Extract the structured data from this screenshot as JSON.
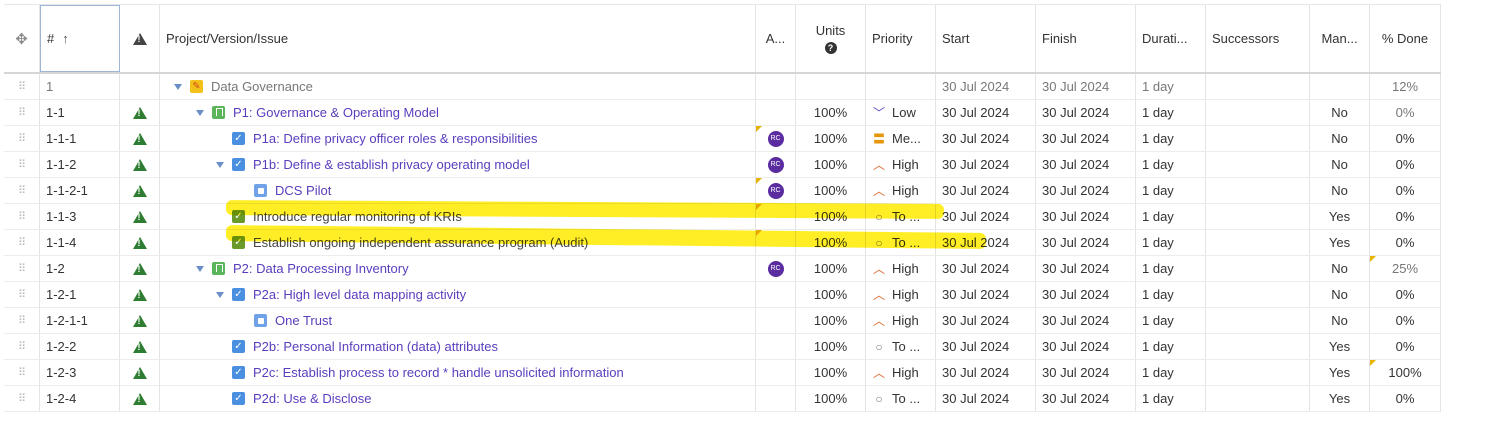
{
  "header": {
    "num": "#",
    "name": "Project/Version/Issue",
    "a": "A...",
    "units": "Units",
    "priority": "Priority",
    "start": "Start",
    "finish": "Finish",
    "duration": "Durati...",
    "successors": "Successors",
    "manual": "Man...",
    "done": "% Done"
  },
  "rows": [
    {
      "num": "1",
      "name": "Data Governance",
      "units": "",
      "priority": "",
      "start": "30 Jul 2024",
      "finish": "30 Jul 2024",
      "duration": "1 day",
      "manual": "",
      "done": "12%"
    },
    {
      "num": "1-1",
      "name": "P1: Governance & Operating Model",
      "units": "100%",
      "priority": "Low",
      "start": "30 Jul 2024",
      "finish": "30 Jul 2024",
      "duration": "1 day",
      "manual": "No",
      "done": "0%"
    },
    {
      "num": "1-1-1",
      "name": "P1a: Define privacy officer roles & responsibilities",
      "units": "100%",
      "priority": "Me...",
      "start": "30 Jul 2024",
      "finish": "30 Jul 2024",
      "duration": "1 day",
      "manual": "No",
      "done": "0%",
      "avatar": "RC"
    },
    {
      "num": "1-1-2",
      "name": "P1b: Define & establish privacy operating model",
      "units": "100%",
      "priority": "High",
      "start": "30 Jul 2024",
      "finish": "30 Jul 2024",
      "duration": "1 day",
      "manual": "No",
      "done": "0%",
      "avatar": "RC"
    },
    {
      "num": "1-1-2-1",
      "name": "DCS Pilot",
      "units": "100%",
      "priority": "High",
      "start": "30 Jul 2024",
      "finish": "30 Jul 2024",
      "duration": "1 day",
      "manual": "No",
      "done": "0%",
      "avatar": "RC"
    },
    {
      "num": "1-1-3",
      "name": "Introduce regular monitoring of KRIs",
      "units": "100%",
      "priority": "To ...",
      "start": "30 Jul 2024",
      "finish": "30 Jul 2024",
      "duration": "1 day",
      "manual": "Yes",
      "done": "0%"
    },
    {
      "num": "1-1-4",
      "name": "Establish ongoing independent assurance program (Audit)",
      "units": "100%",
      "priority": "To ...",
      "start": "30 Jul 2024",
      "finish": "30 Jul 2024",
      "duration": "1 day",
      "manual": "Yes",
      "done": "0%"
    },
    {
      "num": "1-2",
      "name": "P2: Data Processing Inventory",
      "units": "100%",
      "priority": "High",
      "start": "30 Jul 2024",
      "finish": "30 Jul 2024",
      "duration": "1 day",
      "manual": "No",
      "done": "25%",
      "avatar": "RC"
    },
    {
      "num": "1-2-1",
      "name": "P2a: High level data mapping activity",
      "units": "100%",
      "priority": "High",
      "start": "30 Jul 2024",
      "finish": "30 Jul 2024",
      "duration": "1 day",
      "manual": "No",
      "done": "0%"
    },
    {
      "num": "1-2-1-1",
      "name": "One Trust",
      "units": "100%",
      "priority": "High",
      "start": "30 Jul 2024",
      "finish": "30 Jul 2024",
      "duration": "1 day",
      "manual": "No",
      "done": "0%"
    },
    {
      "num": "1-2-2",
      "name": "P2b: Personal Information (data) attributes",
      "units": "100%",
      "priority": "To ...",
      "start": "30 Jul 2024",
      "finish": "30 Jul 2024",
      "duration": "1 day",
      "manual": "Yes",
      "done": "0%"
    },
    {
      "num": "1-2-3",
      "name": "P2c: Establish process to record * handle unsolicited information",
      "units": "100%",
      "priority": "High",
      "start": "30 Jul 2024",
      "finish": "30 Jul 2024",
      "duration": "1 day",
      "manual": "Yes",
      "done": "100%"
    },
    {
      "num": "1-2-4",
      "name": "P2d: Use & Disclose",
      "units": "100%",
      "priority": "To ...",
      "start": "30 Jul 2024",
      "finish": "30 Jul 2024",
      "duration": "1 day",
      "manual": "Yes",
      "done": "0%"
    }
  ]
}
